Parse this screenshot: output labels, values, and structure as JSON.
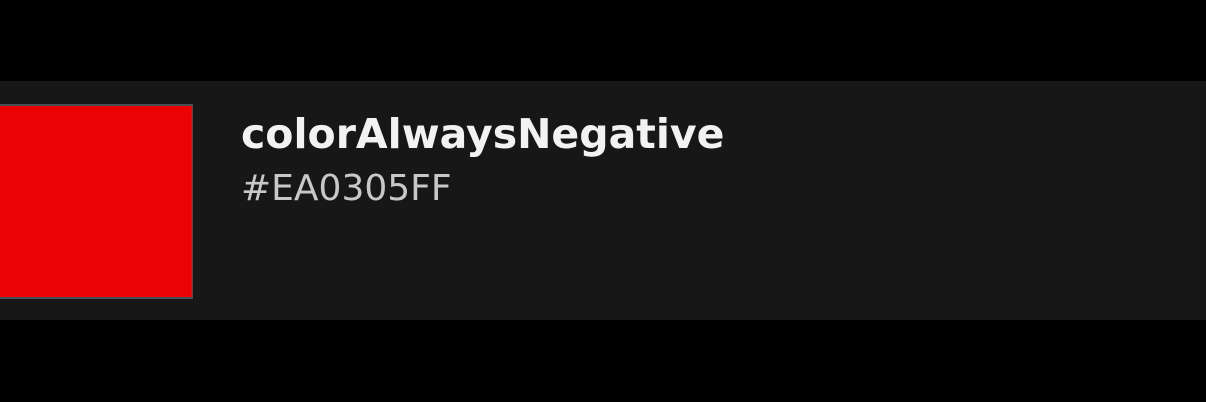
{
  "color_item": {
    "name": "colorAlwaysNegative",
    "hex_label": "#EA0305FF",
    "swatch_color": "#EA0305"
  },
  "colors": {
    "background": "#000000",
    "row_background": "#171717",
    "swatch_border": "#4a4f55"
  }
}
